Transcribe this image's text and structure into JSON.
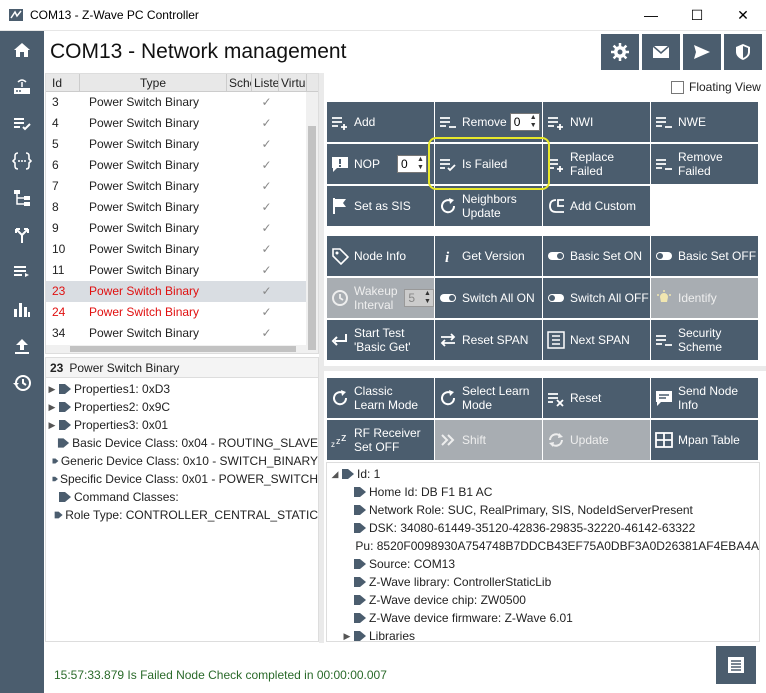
{
  "window": {
    "title": "COM13 - Z-Wave PC Controller",
    "minimize": "—",
    "maximize": "☐",
    "close": "✕"
  },
  "page": {
    "title": "COM13  - Network management"
  },
  "floating_view": {
    "label": "Floating View",
    "checked": false
  },
  "grid": {
    "columns": [
      "Id",
      "Type",
      "Sche",
      "Liste",
      "Virtu"
    ],
    "rows": [
      {
        "id": "3",
        "type": "Power Switch Binary",
        "listening": "✓",
        "color": "normal"
      },
      {
        "id": "4",
        "type": "Power Switch Binary",
        "listening": "✓",
        "color": "normal"
      },
      {
        "id": "5",
        "type": "Power Switch Binary",
        "listening": "✓",
        "color": "normal"
      },
      {
        "id": "6",
        "type": "Power Switch Binary",
        "listening": "✓",
        "color": "normal"
      },
      {
        "id": "7",
        "type": "Power Switch Binary",
        "listening": "✓",
        "color": "normal"
      },
      {
        "id": "8",
        "type": "Power Switch Binary",
        "listening": "✓",
        "color": "normal"
      },
      {
        "id": "9",
        "type": "Power Switch Binary",
        "listening": "✓",
        "color": "normal"
      },
      {
        "id": "10",
        "type": "Power Switch Binary",
        "listening": "✓",
        "color": "normal"
      },
      {
        "id": "11",
        "type": "Power Switch Binary",
        "listening": "✓",
        "color": "normal"
      },
      {
        "id": "23",
        "type": "Power Switch Binary",
        "listening": "✓",
        "color": "red",
        "selected": true
      },
      {
        "id": "24",
        "type": "Power Switch Binary",
        "listening": "✓",
        "color": "red"
      },
      {
        "id": "34",
        "type": "Power Switch Binary",
        "listening": "✓",
        "color": "normal"
      }
    ]
  },
  "node_details": {
    "header_id": "23",
    "header_type": "Power Switch Binary",
    "items": [
      {
        "text": "Properties1: 0xD3",
        "expandable": true
      },
      {
        "text": "Properties2: 0x9C",
        "expandable": true
      },
      {
        "text": "Properties3: 0x01",
        "expandable": true
      },
      {
        "text": "Basic Device Class: 0x04 - ROUTING_SLAVE",
        "expandable": false
      },
      {
        "text": "Generic Device Class: 0x10 - SWITCH_BINARY",
        "expandable": false
      },
      {
        "text": "Specific Device Class: 0x01 - POWER_SWITCH",
        "expandable": false
      },
      {
        "text": "Command Classes:",
        "expandable": false
      },
      {
        "text": "Role Type: CONTROLLER_CENTRAL_STATIC",
        "expandable": false
      }
    ]
  },
  "buttons": {
    "add": "Add",
    "remove": "Remove",
    "remove_value": "0",
    "nwi": "NWI",
    "nwe": "NWE",
    "nop": "NOP",
    "nop_value": "0",
    "is_failed": "Is Failed",
    "replace_failed": "Replace Failed",
    "remove_failed": "Remove Failed",
    "set_as_sis": "Set as SIS",
    "neighbors_update": "Neighbors Update",
    "add_custom": "Add Custom",
    "node_info": "Node Info",
    "get_version": "Get Version",
    "basic_set_on": "Basic Set ON",
    "basic_set_off": "Basic Set OFF",
    "wakeup_interval": "Wakeup Interval",
    "wakeup_value": "5",
    "switch_all_on": "Switch All ON",
    "switch_all_off": "Switch All OFF",
    "identify": "Identify",
    "start_test": "Start Test 'Basic Get'",
    "reset_span": "Reset SPAN",
    "next_span": "Next SPAN",
    "security_scheme": "Security Scheme",
    "classic_learn": "Classic Learn Mode",
    "select_learn": "Select Learn Mode",
    "reset": "Reset",
    "send_node_info": "Send Node Info",
    "rf_receiver": "RF Receiver Set OFF",
    "shift": "Shift",
    "update": "Update",
    "mpan_table": "Mpan Table"
  },
  "controller_tree": {
    "root": "Id: 1",
    "items": [
      "Home Id: DB F1 B1 AC",
      "Network Role: SUC, RealPrimary, SIS, NodeIdServerPresent",
      "DSK: 34080-61449-35120-42836-29835-32220-46142-63322",
      "Pu: 8520F0098930A754748B7DDCB43EF75A0DBF3A0D26381AF4EBA4A",
      "Source: COM13",
      "Z-Wave library: ControllerStaticLib",
      "Z-Wave device chip: ZW0500",
      "Z-Wave device firmware: Z-Wave 6.01"
    ],
    "libraries": "Libraries"
  },
  "status": {
    "text": "15:57:33.879 Is Failed Node Check completed in 00:00:00.007"
  },
  "colors": {
    "accent": "#4b5d6e",
    "disabled": "#a8adb2",
    "highlight": "#e8e82a",
    "failed_node": "#e01010",
    "status": "#2a6a2a"
  }
}
